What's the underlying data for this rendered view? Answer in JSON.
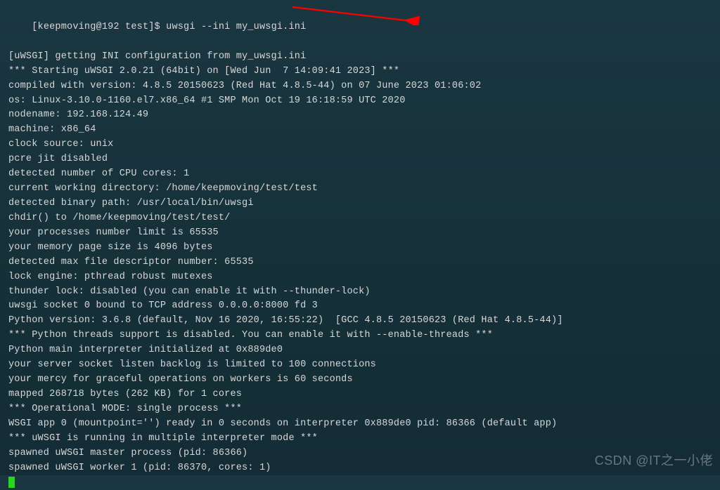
{
  "terminal": {
    "prompt": "[keepmoving@192 test]$ uwsgi --ini my_uwsgi.ini",
    "lines": [
      "[uWSGI] getting INI configuration from my_uwsgi.ini",
      "*** Starting uWSGI 2.0.21 (64bit) on [Wed Jun  7 14:09:41 2023] ***",
      "compiled with version: 4.8.5 20150623 (Red Hat 4.8.5-44) on 07 June 2023 01:06:02",
      "os: Linux-3.10.0-1160.el7.x86_64 #1 SMP Mon Oct 19 16:18:59 UTC 2020",
      "nodename: 192.168.124.49",
      "machine: x86_64",
      "clock source: unix",
      "pcre jit disabled",
      "detected number of CPU cores: 1",
      "current working directory: /home/keepmoving/test/test",
      "detected binary path: /usr/local/bin/uwsgi",
      "chdir() to /home/keepmoving/test/test/",
      "your processes number limit is 65535",
      "your memory page size is 4096 bytes",
      "detected max file descriptor number: 65535",
      "lock engine: pthread robust mutexes",
      "thunder lock: disabled (you can enable it with --thunder-lock)",
      "uwsgi socket 0 bound to TCP address 0.0.0.0:8000 fd 3",
      "Python version: 3.6.8 (default, Nov 16 2020, 16:55:22)  [GCC 4.8.5 20150623 (Red Hat 4.8.5-44)]",
      "*** Python threads support is disabled. You can enable it with --enable-threads ***",
      "Python main interpreter initialized at 0x889de0",
      "your server socket listen backlog is limited to 100 connections",
      "your mercy for graceful operations on workers is 60 seconds",
      "mapped 268718 bytes (262 KB) for 1 cores",
      "*** Operational MODE: single process ***",
      "WSGI app 0 (mountpoint='') ready in 0 seconds on interpreter 0x889de0 pid: 86366 (default app)",
      "*** uWSGI is running in multiple interpreter mode ***",
      "spawned uWSGI master process (pid: 86366)",
      "spawned uWSGI worker 1 (pid: 86370, cores: 1)"
    ]
  },
  "annotation": {
    "arrow_stroke": "#ff0000"
  },
  "watermark": {
    "text": "CSDN @IT之一小佬"
  }
}
